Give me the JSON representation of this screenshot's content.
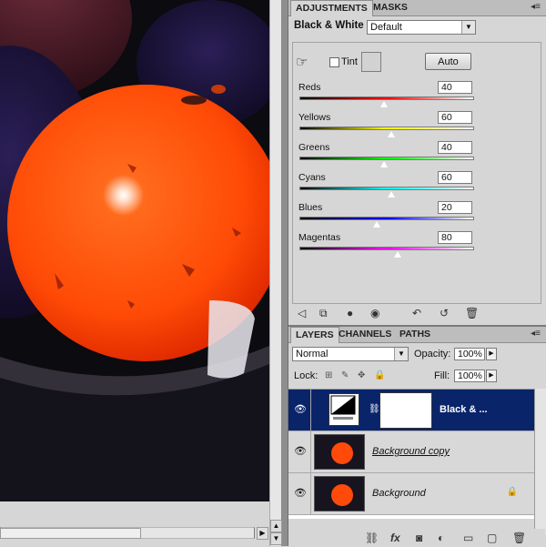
{
  "adjustments_panel": {
    "tabs": [
      "ADJUSTMENTS",
      "MASKS"
    ],
    "menu_icon": "panel-menu-icon",
    "adjustment_name": "Black & White",
    "preset_value": "Default",
    "tint_label": "Tint",
    "tint_checked": false,
    "auto_label": "Auto",
    "sliders": [
      {
        "label": "Reds",
        "value": "40",
        "pos": 0.47
      },
      {
        "label": "Yellows",
        "value": "60",
        "pos": 0.52
      },
      {
        "label": "Greens",
        "value": "40",
        "pos": 0.47
      },
      {
        "label": "Cyans",
        "value": "60",
        "pos": 0.52
      },
      {
        "label": "Blues",
        "value": "20",
        "pos": 0.44
      },
      {
        "label": "Magentas",
        "value": "80",
        "pos": 0.56
      }
    ]
  },
  "layers_panel": {
    "tabs": [
      "LAYERS",
      "CHANNELS",
      "PATHS"
    ],
    "blend_mode": "Normal",
    "opacity_label": "Opacity:",
    "opacity_value": "100%",
    "lock_label": "Lock:",
    "fill_label": "Fill:",
    "fill_value": "100%",
    "layers": [
      {
        "name": "Black & ...",
        "selected": true,
        "type": "adjustment"
      },
      {
        "name": "Background copy",
        "selected": false,
        "type": "image"
      },
      {
        "name": "Background",
        "selected": false,
        "type": "image",
        "locked": true
      }
    ]
  },
  "colors": {
    "selection": "#0a246a",
    "ball": "#ff4a0a",
    "panel_bg": "#d6d6d6"
  }
}
